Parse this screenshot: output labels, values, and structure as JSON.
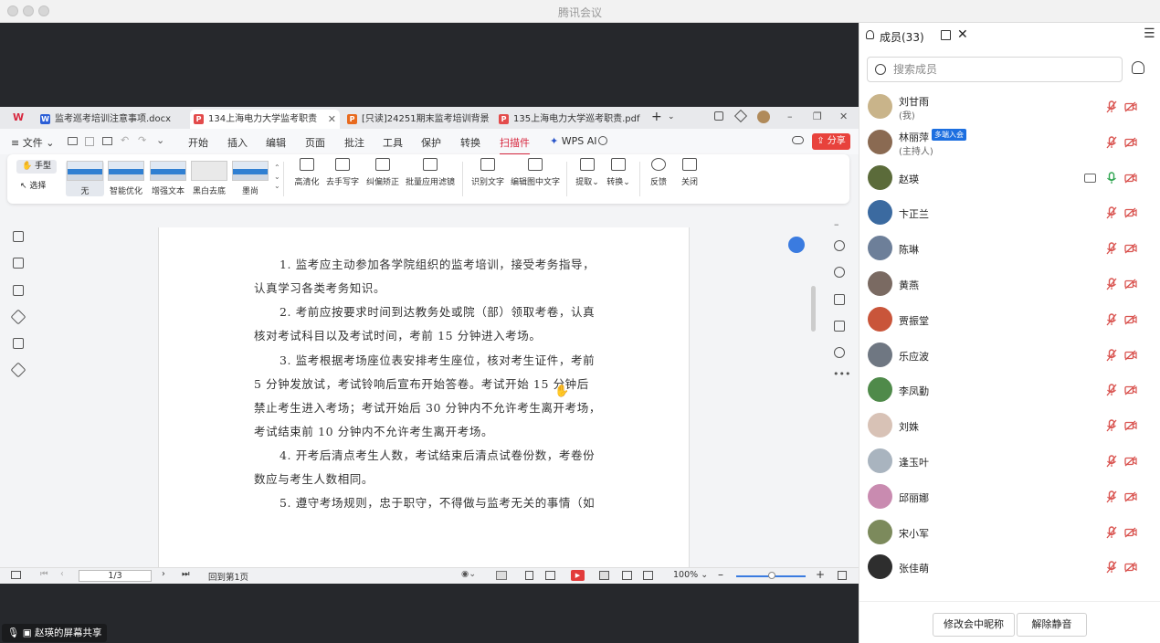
{
  "window": {
    "title": "腾讯会议"
  },
  "wps": {
    "tabs": [
      {
        "label": "监考巡考培训注意事项.docx",
        "icon": "W",
        "icon_color": "#2b5ed6"
      },
      {
        "label": "134上海电力大学监考职责",
        "icon": "P",
        "icon_color": "#e34b4b"
      },
      {
        "label": "[只读]24251期末监考培训背景",
        "icon": "P",
        "icon_color": "#e86a1e"
      },
      {
        "label": "135上海电力大学巡考职责.pdf",
        "icon": "P",
        "icon_color": "#e34b4b"
      }
    ],
    "menu": {
      "file": "文件",
      "items": [
        "开始",
        "插入",
        "编辑",
        "页面",
        "批注",
        "工具",
        "保护",
        "转换",
        "扫描件"
      ],
      "active": "扫描件",
      "wps_ai": "WPS AI",
      "share": "分享"
    },
    "ribbon": {
      "hand": "手型",
      "select": "选择",
      "filters": [
        "无",
        "智能优化",
        "增强文本",
        "黑白去底",
        "墨尚"
      ],
      "tools": [
        "高清化",
        "去手写字",
        "纠偏矫正",
        "批量应用滤镜",
        "识别文字",
        "编辑图中文字",
        "提取",
        "转换",
        "反馈",
        "关闭"
      ]
    },
    "document_lines": [
      "1. 监考应主动参加各学院组织的监考培训，接受考务指导，",
      "认真学习各类考务知识。",
      "2. 考前应按要求时间到达教务处或院（部）领取考卷，认真",
      "核对考试科目以及考试时间，考前 15 分钟进入考场。",
      "3. 监考根据考场座位表安排考生座位，核对考生证件，考前",
      "5 分钟发放试，考试铃响后宣布开始答卷。考试开始 15 分钟后",
      "禁止考生进入考场；考试开始后 30 分钟内不允许考生离开考场，",
      "考试结束前 10 分钟内不允许考生离开考场。",
      "4. 开考后清点考生人数，考试结束后清点试卷份数，考卷份",
      "数应与考生人数相同。",
      "5. 遵守考场规则，忠于职守，不得做与监考无关的事情（如"
    ],
    "status": {
      "page": "1/3",
      "back_to": "回到第1页",
      "zoom": "100%"
    }
  },
  "share_label": "赵瑛的屏幕共享",
  "panel": {
    "title": "成员(33)",
    "search_placeholder": "搜索成员",
    "members": [
      {
        "name": "刘甘雨",
        "role": "(我)",
        "avatar_color": "#c9b48a"
      },
      {
        "name": "林丽萍",
        "role": "(主持人)",
        "tag": "多端入会",
        "avatar_color": "#8a6a52"
      },
      {
        "name": "赵瑛",
        "avatar_color": "#5b6b3a",
        "mic_active": true,
        "sharing": true
      },
      {
        "name": "卞正兰",
        "avatar_color": "#3b6aa0"
      },
      {
        "name": "陈琳",
        "avatar_color": "#6d7f99"
      },
      {
        "name": "黄燕",
        "avatar_color": "#7a6a62"
      },
      {
        "name": "贾振堂",
        "avatar_color": "#c9553a"
      },
      {
        "name": "乐应波",
        "avatar_color": "#6f7782"
      },
      {
        "name": "李凤勤",
        "avatar_color": "#4f8a4a"
      },
      {
        "name": "刘姝",
        "avatar_color": "#d8c2b6"
      },
      {
        "name": "逢玉叶",
        "avatar_color": "#a9b4bf"
      },
      {
        "name": "邱丽娜",
        "avatar_color": "#c98bb0"
      },
      {
        "name": "宋小军",
        "avatar_color": "#7c8a5c"
      },
      {
        "name": "张佳萌",
        "avatar_color": "#2e2e2e"
      }
    ],
    "rename_button": "修改会中昵称",
    "unmute_button": "解除静音"
  },
  "colors": {
    "accent_red": "#d7263d",
    "muted_red": "#d9534f",
    "mic_green": "#2ea44f",
    "tag_blue": "#1d6fe0"
  }
}
